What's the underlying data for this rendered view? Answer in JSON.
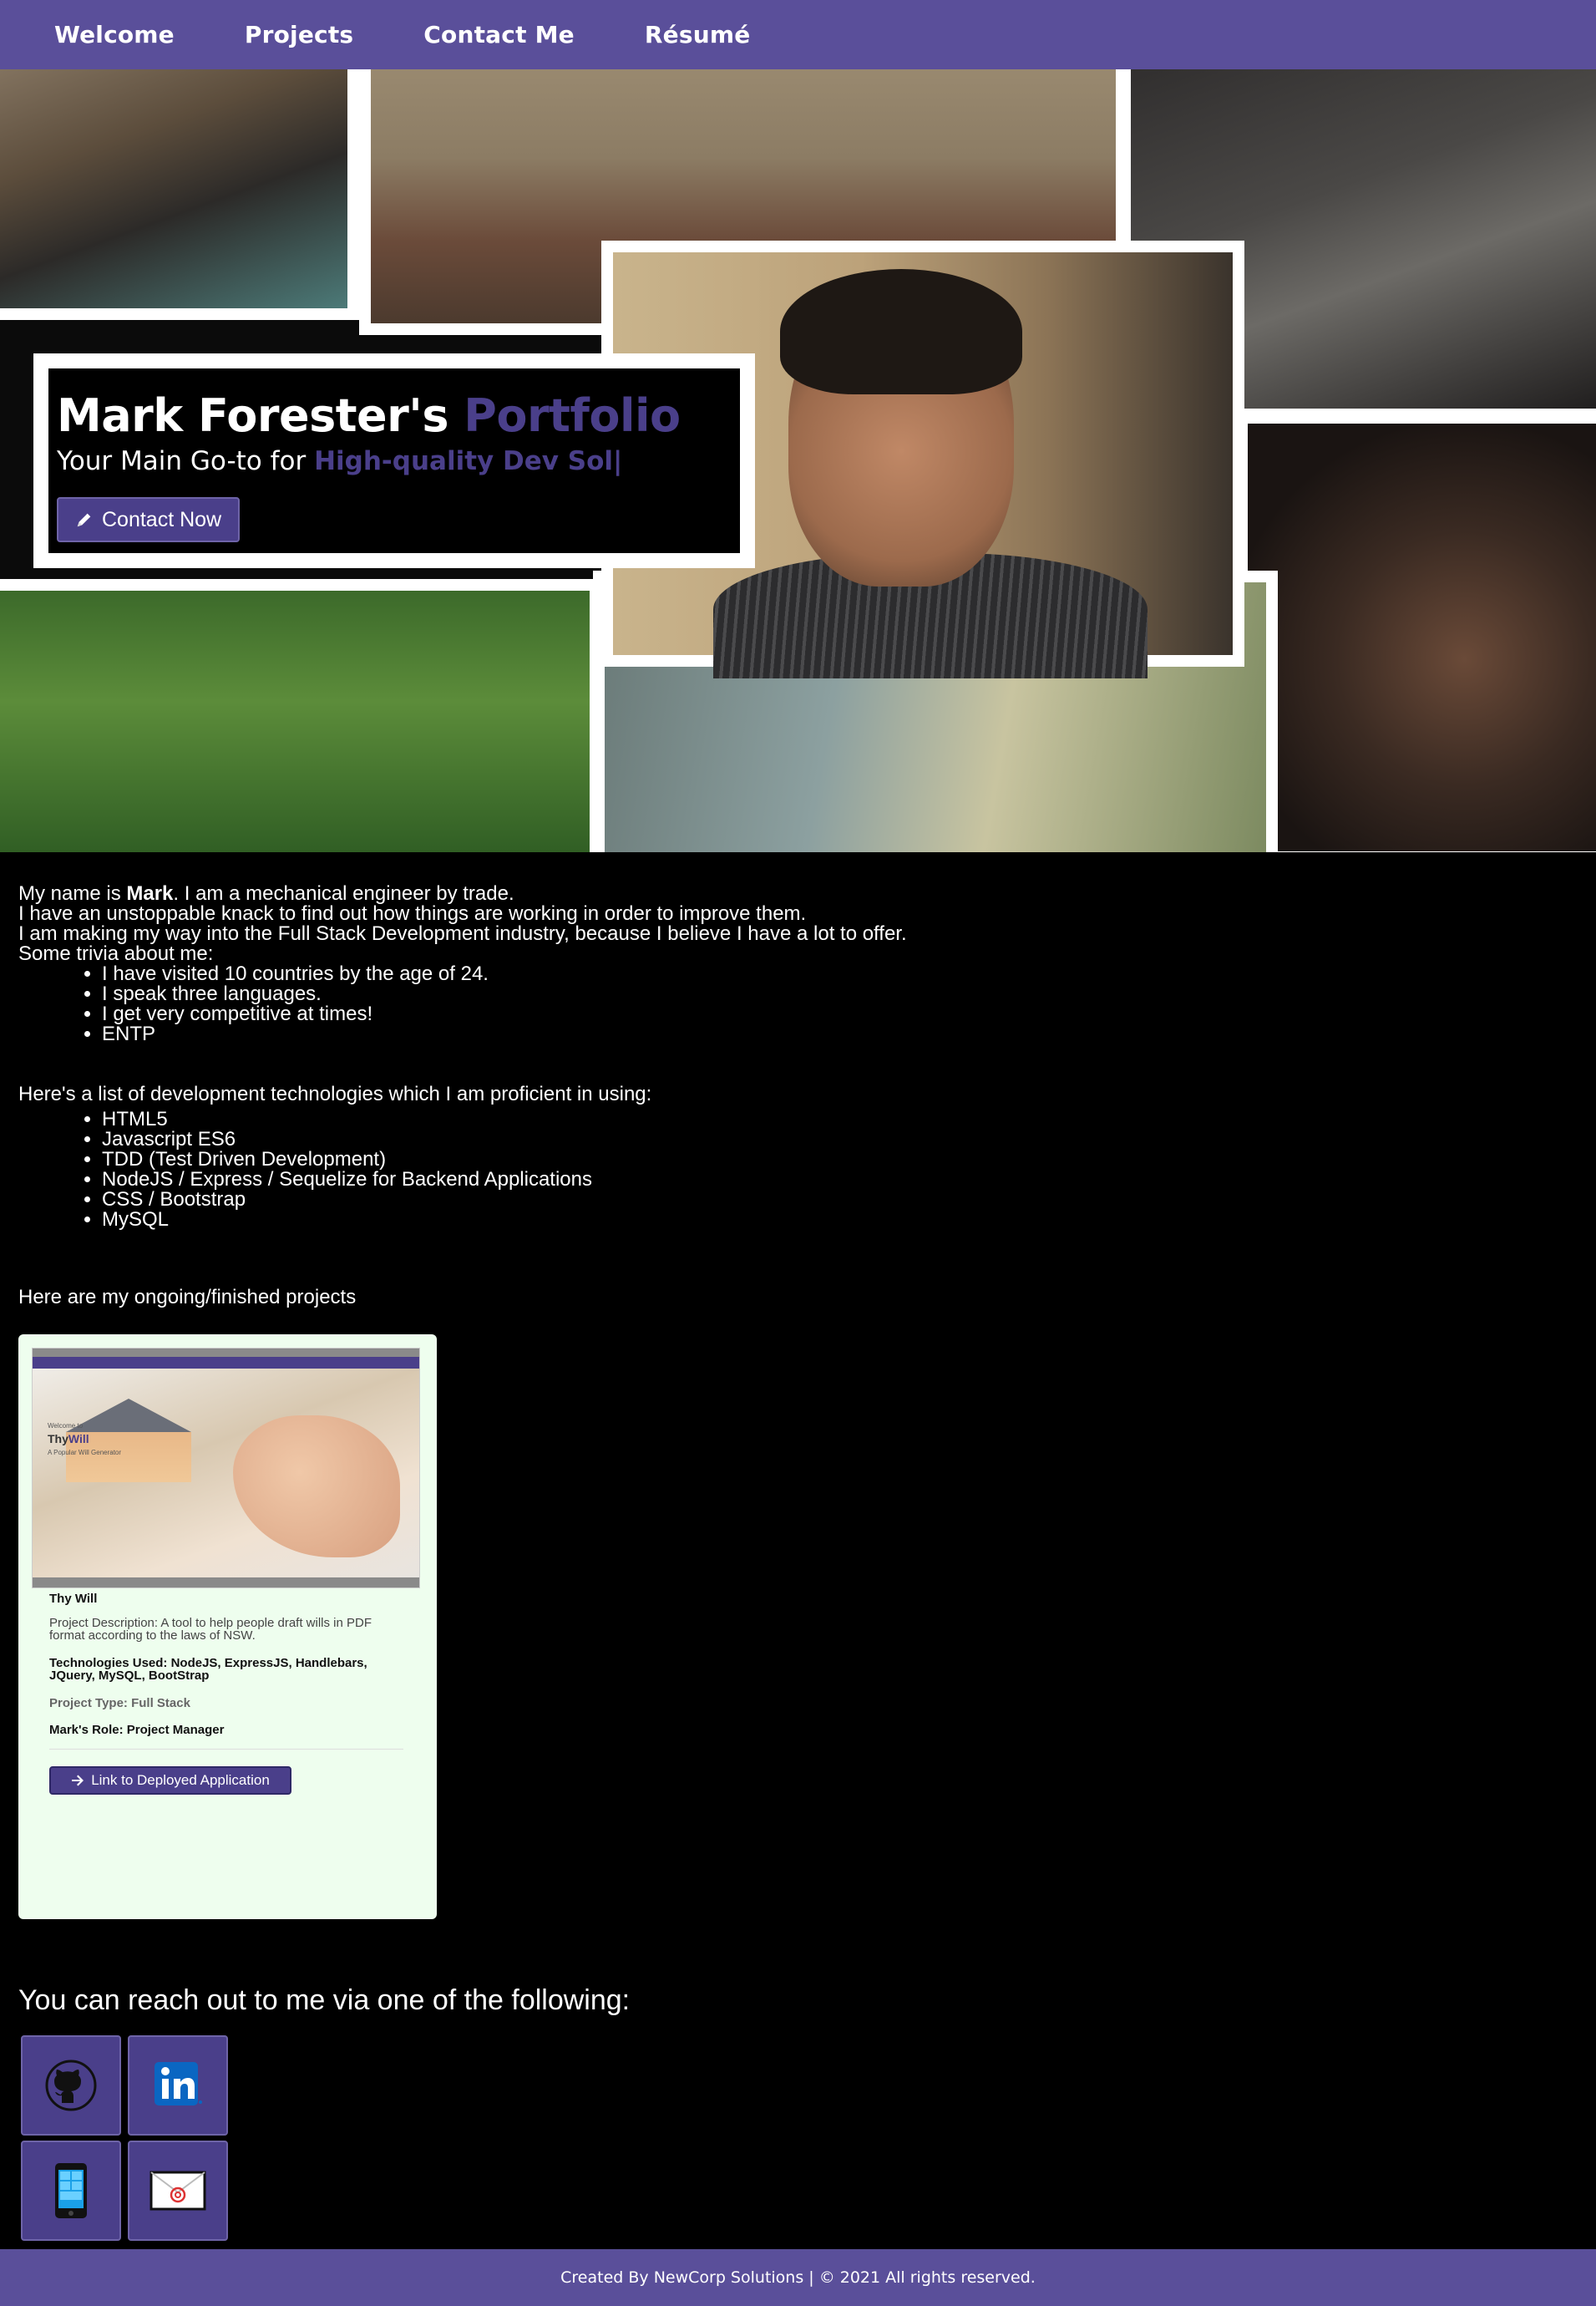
{
  "nav": {
    "items": [
      {
        "label": "Welcome"
      },
      {
        "label": "Projects"
      },
      {
        "label": "Contact Me"
      },
      {
        "label": "Résumé"
      }
    ]
  },
  "hero": {
    "title_main": "Mark Forester's ",
    "title_accent": "Portfolio",
    "tagline_main": "Your Main Go-to for ",
    "tagline_accent": "High-quality Dev Sol|",
    "contact_button": "Contact Now"
  },
  "about": {
    "intro_prefix": "My name is ",
    "intro_name": "Mark",
    "intro_suffix": ". I am a mechanical engineer by trade.",
    "line2": "I have an unstoppable knack to find out how things are working in order to improve them.",
    "line3": "I am making my way into the Full Stack Development industry, because I believe I have a lot to offer.",
    "trivia_heading": "Some trivia about me:",
    "trivia": [
      "I have visited 10 countries by the age of 24.",
      "I speak three languages.",
      "I get very competitive at times!",
      "ENTP"
    ],
    "tech_heading": "Here's a list of development technologies which I am proficient in using:",
    "tech": [
      "HTML5",
      "Javascript ES6",
      "TDD (Test Driven Development)",
      "NodeJS / Express / Sequelize for Backend Applications",
      "CSS / Bootstrap",
      "MySQL"
    ],
    "projects_heading": "Here are my ongoing/finished projects"
  },
  "project": {
    "screenshot_brand_prefix": "Thy",
    "screenshot_brand_accent": "Will",
    "screenshot_caption": "Welcome to",
    "screenshot_tagline": "A Popular Will Generator",
    "title": "Thy Will",
    "description": "Project Description: A tool to help people draft wills in PDF format according to the laws of NSW.",
    "technologies": "Technologies Used: NodeJS, ExpressJS, Handlebars, JQuery, MySQL, BootStrap",
    "type": "Project Type: Full Stack",
    "role": "Mark's Role: Project Manager",
    "link_label": "Link to Deployed Application"
  },
  "contact": {
    "heading": "You can reach out to me via one of the following:",
    "links": [
      {
        "icon": "github-icon"
      },
      {
        "icon": "linkedin-icon"
      },
      {
        "icon": "phone-icon"
      },
      {
        "icon": "email-icon"
      }
    ]
  },
  "footer": {
    "text": "Created By NewCorp Solutions | © 2021 All rights reserved."
  },
  "colors": {
    "nav": "#5a4f9a",
    "accent": "#4a3f8a",
    "card": "#eefeee"
  }
}
